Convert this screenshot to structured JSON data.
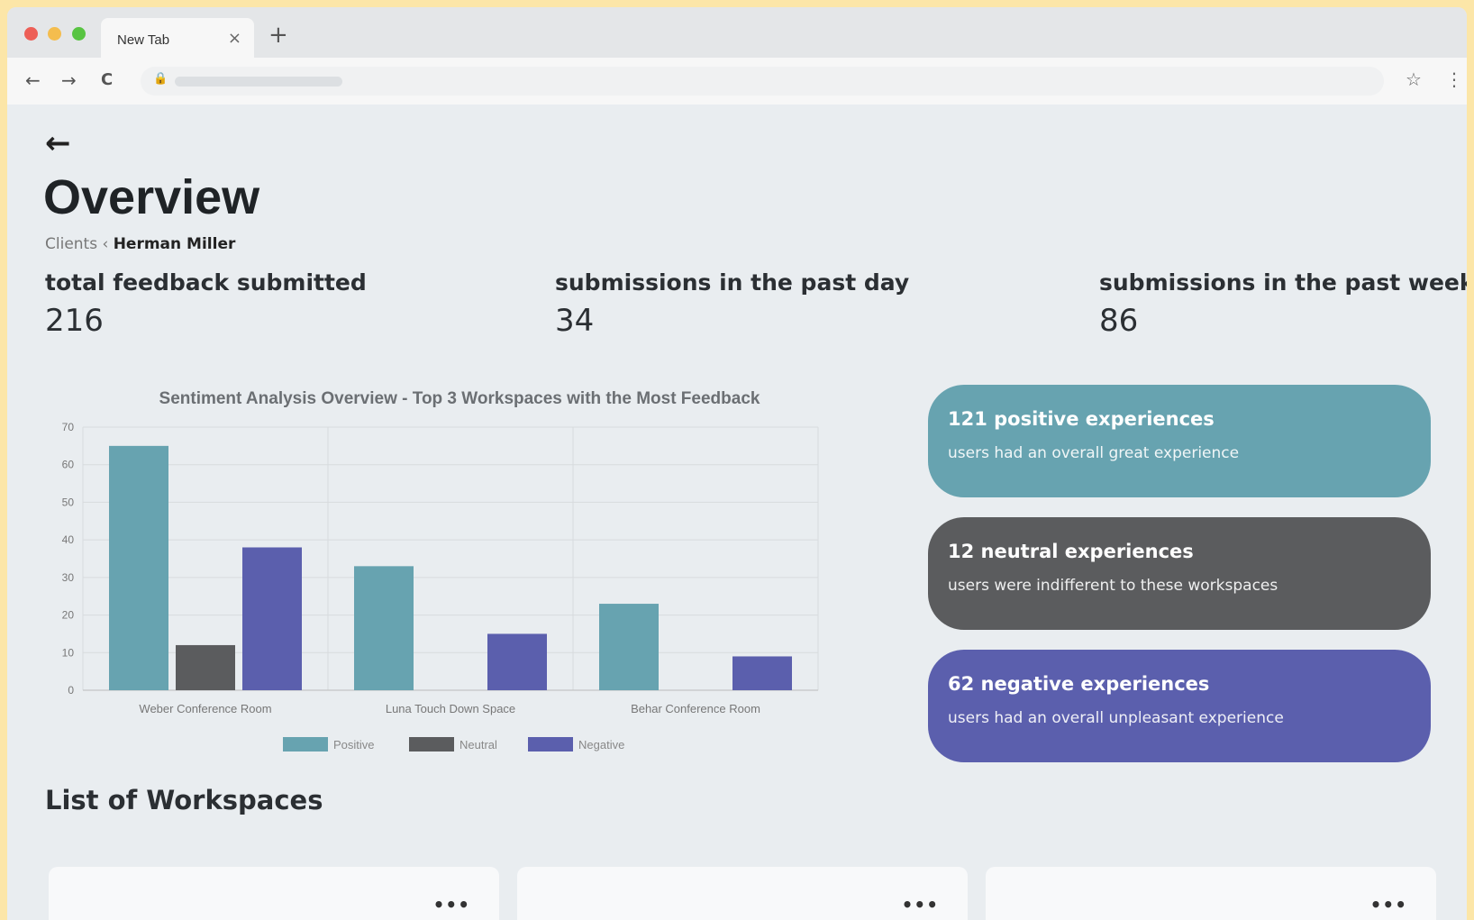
{
  "browser": {
    "tab_title": "New Tab",
    "close_glyph": "×",
    "new_tab_glyph": "+"
  },
  "icons": {
    "back": "←",
    "forward": "→",
    "reload": "C",
    "lock": "🔒",
    "star": "☆",
    "menu": "⋮",
    "page_back": "←",
    "more": "•••"
  },
  "page": {
    "title": "Overview",
    "breadcrumb": {
      "parent": "Clients",
      "separator": "‹",
      "current": "Herman Miller"
    }
  },
  "stats": [
    {
      "label": "total feedback submitted",
      "value": "216"
    },
    {
      "label": "submissions in the past day",
      "value": "34"
    },
    {
      "label": "submissions in the past week",
      "value": "86"
    }
  ],
  "summary_cards": [
    {
      "title": "121 positive experiences",
      "description": "users had an overall great experience",
      "color": "#67a3b0"
    },
    {
      "title": "12 neutral experiences",
      "description": "users were indifferent to these workspaces",
      "color": "#5b5c5e"
    },
    {
      "title": "62 negative experiences",
      "description": "users had an overall unpleasant experience",
      "color": "#5b5fad"
    }
  ],
  "workspaces_section": {
    "title": "List of Workspaces",
    "cards": [
      {
        "menu": "•••"
      },
      {
        "menu": "•••"
      },
      {
        "menu": "•••"
      }
    ]
  },
  "chart_data": {
    "type": "bar",
    "title": "Sentiment Analysis Overview - Top 3 Workspaces with the Most Feedback",
    "categories": [
      "Weber Conference Room",
      "Luna Touch Down Space",
      "Behar Conference Room"
    ],
    "series": [
      {
        "name": "Positive",
        "values": [
          65,
          33,
          23
        ],
        "color": "#67a3b0"
      },
      {
        "name": "Neutral",
        "values": [
          12,
          0,
          0
        ],
        "color": "#5b5c5e"
      },
      {
        "name": "Negative",
        "values": [
          38,
          15,
          9
        ],
        "color": "#5b5fad"
      }
    ],
    "ylim": [
      0,
      70
    ],
    "yticks": [
      0,
      10,
      20,
      30,
      40,
      50,
      60,
      70
    ],
    "grid": true,
    "legend_position": "bottom"
  }
}
